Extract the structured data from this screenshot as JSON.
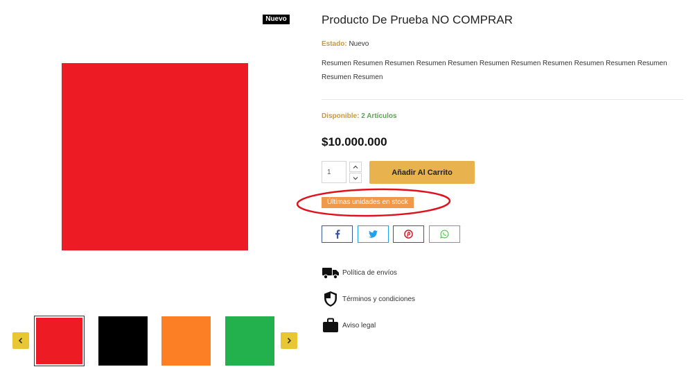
{
  "gallery": {
    "badge": "Nuevo",
    "main_image_color": "#ed1c24",
    "thumbnails": [
      {
        "color": "#ed1c24",
        "active": true
      },
      {
        "color": "#000000",
        "active": false
      },
      {
        "color": "#fd7f25",
        "active": false
      },
      {
        "color": "#22b14c",
        "active": false
      }
    ],
    "prev_icon": "chevron-left-icon",
    "next_icon": "chevron-right-icon"
  },
  "product": {
    "title": "Producto De Prueba NO COMPRAR",
    "condition_label": "Estado:",
    "condition_value": "Nuevo",
    "summary": "Resumen Resumen Resumen Resumen Resumen Resumen Resumen Resumen Resumen Resumen Resumen Resumen Resumen",
    "availability_label": "Disponible:",
    "availability_value": "2 Artículos",
    "price": "$10.000.000",
    "quantity": "1",
    "add_to_cart_label": "Añadir Al Carrito",
    "stock_badge": "Últimas unidades en stock"
  },
  "share": [
    {
      "network": "facebook",
      "icon": "facebook-icon",
      "color": "#3b5998"
    },
    {
      "network": "twitter",
      "icon": "twitter-icon",
      "color": "#1da1f2"
    },
    {
      "network": "pinterest",
      "icon": "pinterest-icon",
      "color": "#cb2027"
    },
    {
      "network": "whatsapp",
      "icon": "whatsapp-icon",
      "color": "#4cc247"
    }
  ],
  "links": [
    {
      "label": "Política de envíos",
      "icon": "truck-icon"
    },
    {
      "label": "Términos y condiciones",
      "icon": "shield-icon"
    },
    {
      "label": "Aviso legal",
      "icon": "briefcase-icon"
    }
  ],
  "colors": {
    "accent_gold": "#c79a38",
    "add_to_cart": "#e8b24e",
    "stock_badge": "#f0994a",
    "available_green": "#5ba354",
    "annotation_red": "#e0101c",
    "arrow_yellow": "#e8c732"
  }
}
